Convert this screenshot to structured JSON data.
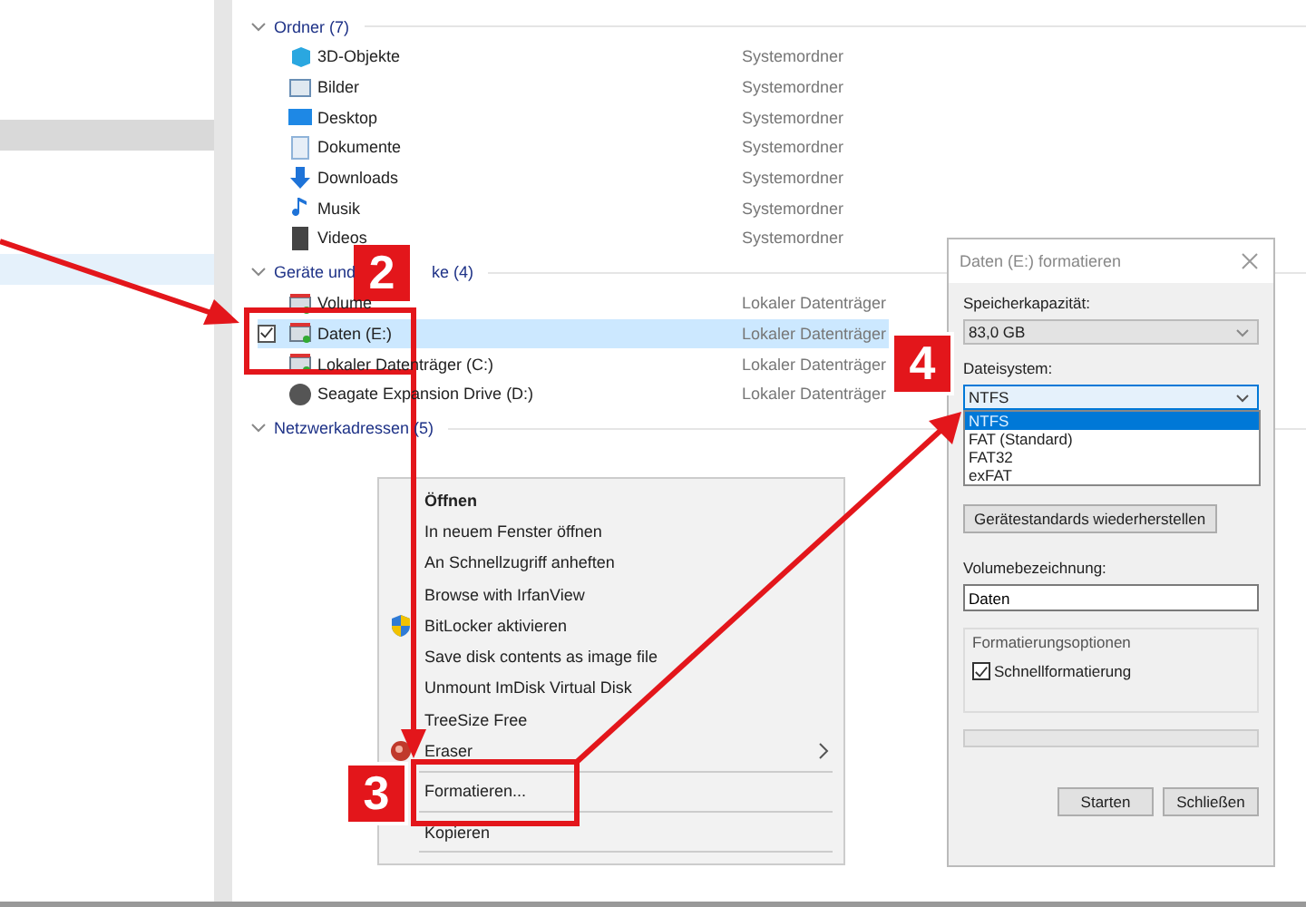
{
  "nav": {
    "items": [
      {
        "selected": true
      },
      {
        "selected": true
      }
    ]
  },
  "groups": [
    {
      "label": "Ordner (7)",
      "items": [
        {
          "name": "3D-Objekte",
          "type": "Systemordner",
          "selected": false,
          "checked": false
        },
        {
          "name": "Bilder",
          "type": "Systemordner",
          "selected": false,
          "checked": false
        },
        {
          "name": "Desktop",
          "type": "Systemordner",
          "selected": false,
          "checked": false
        },
        {
          "name": "Dokumente",
          "type": "Systemordner",
          "selected": false,
          "checked": false
        },
        {
          "name": "Downloads",
          "type": "Systemordner",
          "selected": false,
          "checked": false
        },
        {
          "name": "Musik",
          "type": "Systemordner",
          "selected": false,
          "checked": false
        },
        {
          "name": "Videos",
          "type": "Systemordner",
          "selected": false,
          "checked": false
        }
      ]
    },
    {
      "label": "Geräte und",
      "label_tail": "ke (4)",
      "items": [
        {
          "name": "Volume",
          "type": "Lokaler Datenträger",
          "selected": false,
          "checked": false
        },
        {
          "name": "Daten (E:)",
          "type": "Lokaler Datenträger",
          "selected": true,
          "checked": true
        },
        {
          "name": "Lokaler Datenträger (C:)",
          "type": "Lokaler Datenträger",
          "selected": false,
          "checked": false
        },
        {
          "name": "Seagate Expansion Drive (D:)",
          "type": "Lokaler Datenträger",
          "selected": false,
          "checked": false
        }
      ]
    },
    {
      "label": "Netzwerkadressen (5)"
    }
  ],
  "context_menu": {
    "items": [
      {
        "label": "Öffnen",
        "kind": "item",
        "bold": true
      },
      {
        "label": "In neuem Fenster öffnen",
        "kind": "item",
        "bold": false
      },
      {
        "label": "An Schnellzugriff anheften",
        "kind": "item",
        "bold": false
      },
      {
        "label": "Browse with IrfanView",
        "kind": "item",
        "bold": false
      },
      {
        "label": "BitLocker aktivieren",
        "kind": "item",
        "bold": false
      },
      {
        "label": "Save disk contents as image file",
        "kind": "item",
        "bold": false
      },
      {
        "label": "Unmount ImDisk Virtual Disk",
        "kind": "item",
        "bold": false
      },
      {
        "label": "TreeSize Free",
        "kind": "item",
        "bold": false
      },
      {
        "label": "Eraser",
        "kind": "submenu",
        "bold": false
      },
      {
        "kind": "separator"
      },
      {
        "label": "Formatieren...",
        "kind": "item",
        "bold": false
      },
      {
        "kind": "separator"
      },
      {
        "label": "Kopieren",
        "kind": "item",
        "bold": false
      },
      {
        "kind": "separator"
      }
    ]
  },
  "dialog": {
    "title": "Daten (E:) formatieren",
    "capacity_label": "Speicherkapazität:",
    "capacity": "83,0 GB",
    "filesystem_label": "Dateisystem:",
    "filesystem": "NTFS",
    "filesystem_options": [
      {
        "label": "NTFS",
        "selected": true
      },
      {
        "label": "FAT (Standard)",
        "selected": false
      },
      {
        "label": "FAT32",
        "selected": false
      },
      {
        "label": "exFAT",
        "selected": false
      }
    ],
    "restore_button": "Gerätestandards wiederherstellen",
    "volume_label": "Volumebezeichnung:",
    "volume": "Daten",
    "options_label": "Formatierungsoptionen",
    "quick_format": {
      "label": "Schnellformatierung",
      "checked": true
    },
    "progress": {
      "level": 0
    },
    "buttons": [
      "Starten",
      "Schließen"
    ]
  },
  "markers": [
    "2",
    "3",
    "4"
  ]
}
